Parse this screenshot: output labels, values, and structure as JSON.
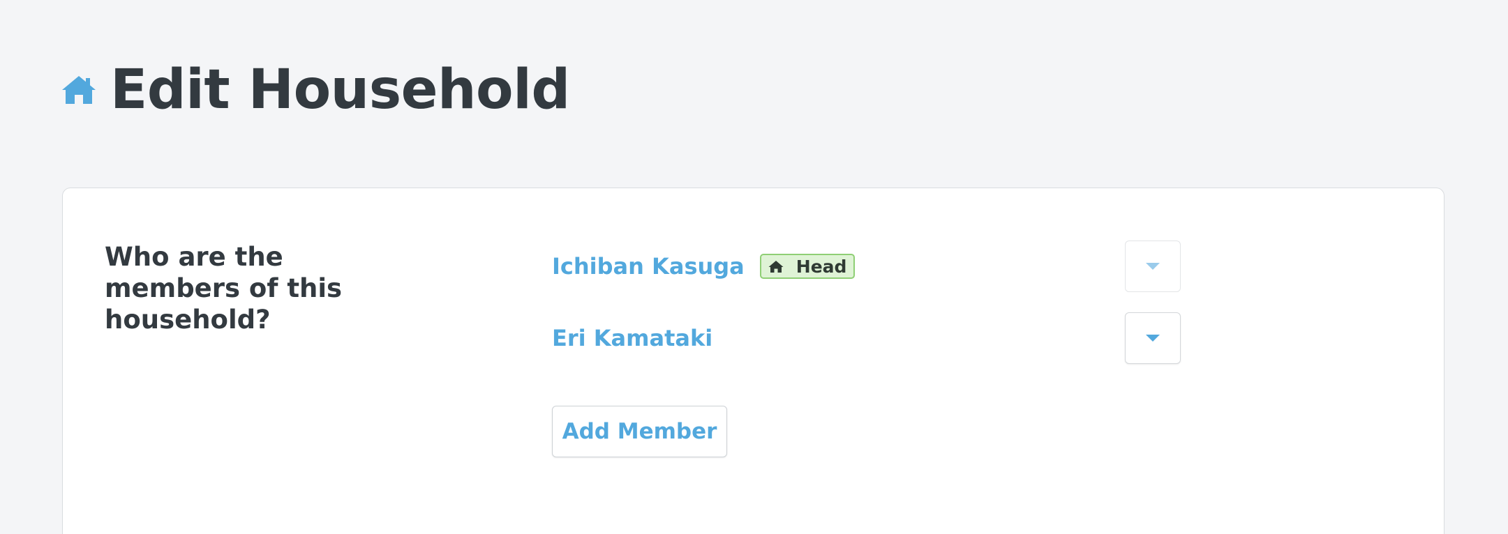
{
  "header": {
    "icon": "home-icon",
    "title": "Edit Household",
    "accent_color": "#52a8dd"
  },
  "card": {
    "question": "Who are the members of this household?",
    "members": [
      {
        "name": "Ichiban Kasuga",
        "badge": {
          "icon": "home-icon",
          "label": "Head"
        }
      },
      {
        "name": "Eri Kamataki",
        "badge": null
      }
    ],
    "add_member_label": "Add Member"
  }
}
